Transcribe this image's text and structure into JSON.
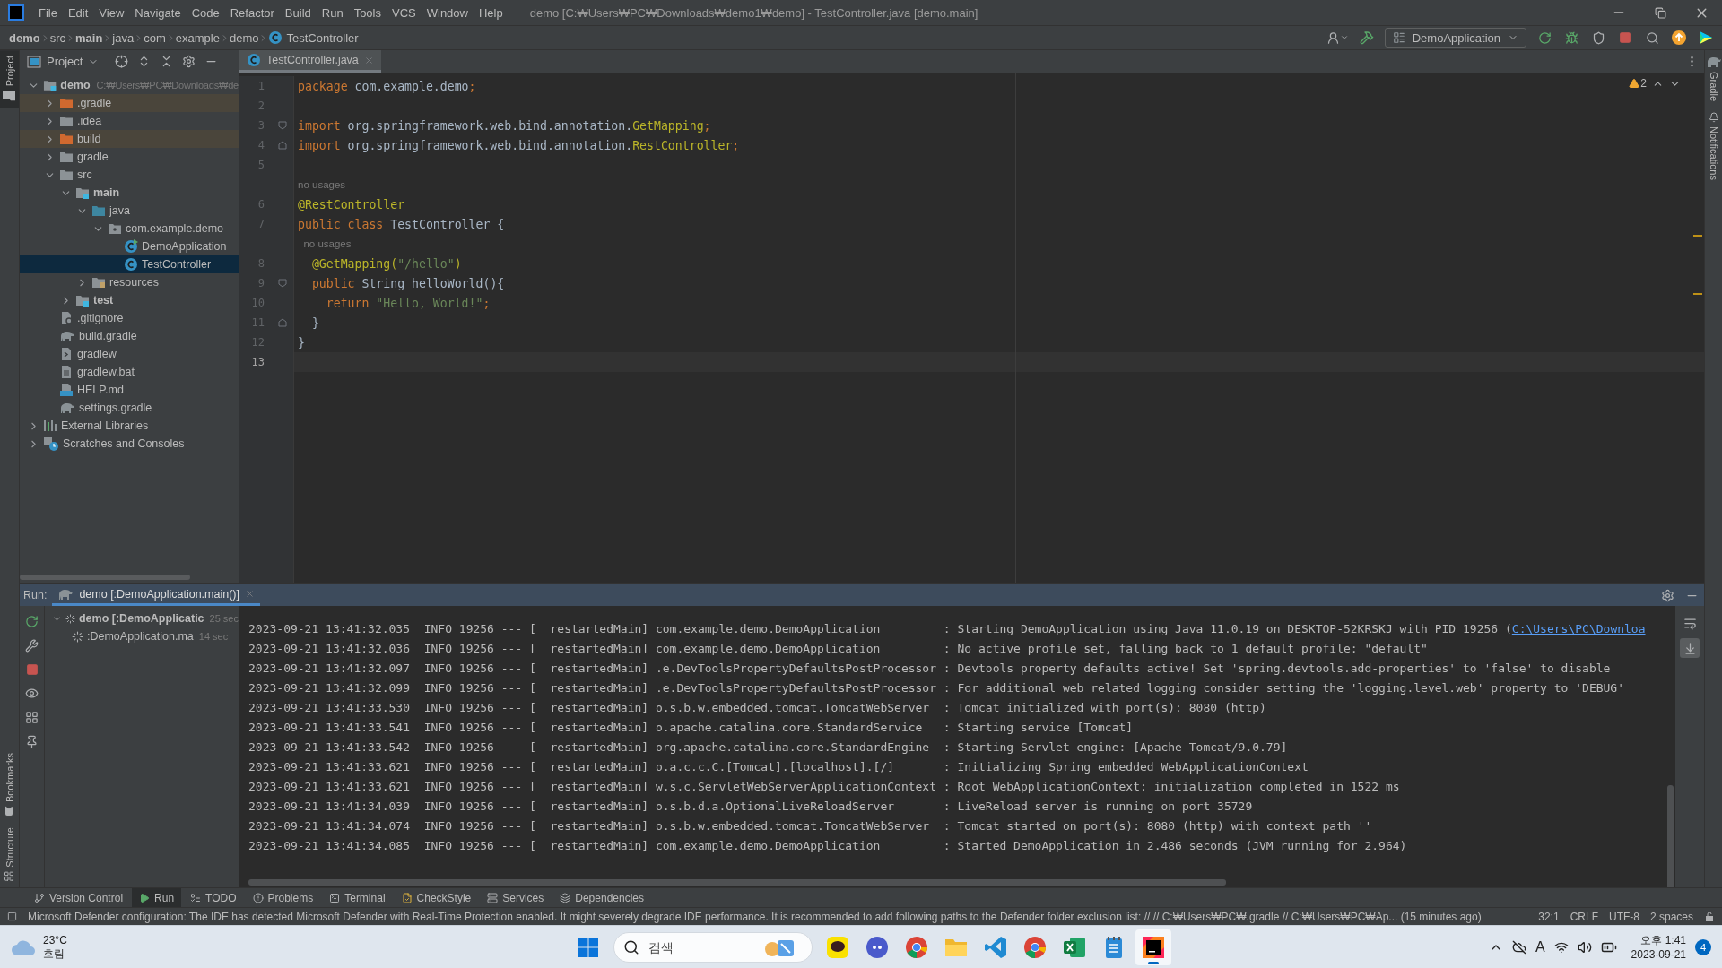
{
  "title_bar": {
    "menu": [
      "File",
      "Edit",
      "View",
      "Navigate",
      "Code",
      "Refactor",
      "Build",
      "Run",
      "Tools",
      "VCS",
      "Window",
      "Help"
    ],
    "title": "demo [C:₩Users₩PC₩Downloads₩demo1₩demo] - TestController.java [demo.main]"
  },
  "navigation_bar": {
    "breadcrumbs": [
      {
        "label": "demo",
        "kind": "module"
      },
      {
        "label": "src",
        "kind": "folder"
      },
      {
        "label": "main",
        "kind": "module"
      },
      {
        "label": "java",
        "kind": "folder"
      },
      {
        "label": "com",
        "kind": "folder"
      },
      {
        "label": "example",
        "kind": "folder"
      },
      {
        "label": "demo",
        "kind": "folder"
      },
      {
        "label": "TestController",
        "kind": "class"
      }
    ],
    "run_configuration": "DemoApplication"
  },
  "left_strip": {
    "top": [
      {
        "label": "Project",
        "selected": true
      }
    ],
    "bottom": [
      {
        "label": "Bookmarks",
        "selected": false
      },
      {
        "label": "Structure",
        "selected": false
      }
    ]
  },
  "right_strip": [
    {
      "label": "Gradle",
      "kind": "gradle"
    },
    {
      "label": "Notifications",
      "kind": "bell"
    }
  ],
  "project_panel": {
    "title": "Project",
    "tree": [
      {
        "label": "demo",
        "kind": "module",
        "hint": "C:₩Users₩PC₩Downloads₩de",
        "expanded": true,
        "selected": false,
        "children": [
          {
            "label": ".gradle",
            "kind": "excluded",
            "expanded": false,
            "selected": false
          },
          {
            "label": ".idea",
            "kind": "folder",
            "expanded": false,
            "selected": false
          },
          {
            "label": "build",
            "kind": "excluded",
            "expanded": false,
            "selected": false
          },
          {
            "label": "gradle",
            "kind": "folder",
            "expanded": false,
            "selected": false
          },
          {
            "label": "src",
            "kind": "folder",
            "expanded": true,
            "selected": false,
            "children": [
              {
                "label": "main",
                "kind": "source-root",
                "expanded": true,
                "selected": false,
                "children": [
                  {
                    "label": "java",
                    "kind": "source",
                    "expanded": true,
                    "selected": false,
                    "children": [
                      {
                        "label": "com.example.demo",
                        "kind": "package",
                        "expanded": true,
                        "selected": false,
                        "children": [
                          {
                            "label": "DemoApplication",
                            "kind": "main-class",
                            "selected": false
                          },
                          {
                            "label": "TestController",
                            "kind": "class",
                            "selected": true
                          }
                        ]
                      }
                    ]
                  },
                  {
                    "label": "resources",
                    "kind": "resources",
                    "expanded": false,
                    "selected": false
                  }
                ]
              },
              {
                "label": "test",
                "kind": "source-root",
                "expanded": false,
                "selected": false
              }
            ]
          },
          {
            "label": ".gitignore",
            "kind": "ignore",
            "selected": false
          },
          {
            "label": "build.gradle",
            "kind": "gradle",
            "selected": false
          },
          {
            "label": "gradlew",
            "kind": "script",
            "selected": false
          },
          {
            "label": "gradlew.bat",
            "kind": "text",
            "selected": false
          },
          {
            "label": "HELP.md",
            "kind": "markdown",
            "selected": false
          },
          {
            "label": "settings.gradle",
            "kind": "gradle",
            "selected": false
          }
        ]
      },
      {
        "label": "External Libraries",
        "kind": "libraries",
        "expanded": false,
        "selected": false
      },
      {
        "label": "Scratches and Consoles",
        "kind": "scratches",
        "expanded": false,
        "selected": false
      }
    ]
  },
  "editor": {
    "tabs": [
      {
        "label": "TestController.java",
        "selected": true
      }
    ],
    "warning_count": "2",
    "lines": [
      {
        "number": "1",
        "tokens": [
          {
            "kind": "keyword",
            "text": "package"
          },
          {
            "kind": "plain",
            "text": " com.example.demo"
          },
          {
            "kind": "keyword",
            "text": ";"
          }
        ]
      },
      {
        "number": "2"
      },
      {
        "number": "3",
        "fold_open": true,
        "tokens": [
          {
            "kind": "keyword",
            "text": "import"
          },
          {
            "kind": "plain",
            "text": " org.springframework.web.bind.annotation."
          },
          {
            "kind": "annotation",
            "text": "GetMapping"
          },
          {
            "kind": "keyword",
            "text": ";"
          }
        ]
      },
      {
        "number": "4",
        "fold_close": true,
        "tokens": [
          {
            "kind": "keyword",
            "text": "import"
          },
          {
            "kind": "plain",
            "text": " org.springframework.web.bind.annotation."
          },
          {
            "kind": "annotation",
            "text": "RestController"
          },
          {
            "kind": "keyword",
            "text": ";"
          }
        ]
      },
      {
        "number": "5"
      },
      {
        "tokens": [
          {
            "kind": "hint",
            "text": "no usages"
          }
        ]
      },
      {
        "number": "6",
        "tokens": [
          {
            "kind": "annotation",
            "text": "@RestController"
          }
        ]
      },
      {
        "number": "7",
        "tokens": [
          {
            "kind": "keyword",
            "text": "public class"
          },
          {
            "kind": "plain",
            "text": " TestController {"
          }
        ]
      },
      {
        "tokens": [
          {
            "kind": "hint",
            "text": "  no usages"
          }
        ]
      },
      {
        "number": "8",
        "tokens": [
          {
            "kind": "annotation",
            "text": "  @GetMapping("
          },
          {
            "kind": "string",
            "text": "\"/hello\""
          },
          {
            "kind": "annotation",
            "text": ")"
          }
        ]
      },
      {
        "number": "9",
        "fold_open": true,
        "tokens": [
          {
            "kind": "keyword",
            "text": "  public"
          },
          {
            "kind": "plain",
            "text": " String helloWorld(){"
          }
        ]
      },
      {
        "number": "10",
        "tokens": [
          {
            "kind": "keyword",
            "text": "    return"
          },
          {
            "kind": "string",
            "text": " \"Hello, World!\""
          },
          {
            "kind": "keyword",
            "text": ";"
          }
        ]
      },
      {
        "number": "11",
        "fold_close": true,
        "tokens": [
          {
            "kind": "plain",
            "text": "  }"
          }
        ]
      },
      {
        "number": "12",
        "tokens": [
          {
            "kind": "plain",
            "text": "}"
          }
        ]
      },
      {
        "number": "13",
        "current": true
      }
    ]
  },
  "run_panel": {
    "label": "Run:",
    "tabs": [
      {
        "label": "demo [:DemoApplication.main()]",
        "selected": true
      }
    ],
    "tree": [
      {
        "label": "demo [:DemoApplicatic",
        "time": "25 sec",
        "expanded": true,
        "children": [
          {
            "label": ":DemoApplication.ma",
            "time": "14 sec"
          }
        ]
      }
    ],
    "console": [
      {
        "text": "2023-09-21 13:41:32.035  INFO 19256 --- [  restartedMain] com.example.demo.DemoApplication         : Starting DemoApplication using Java 11.0.19 on DESKTOP-52KRSKJ with PID 19256 (",
        "link": "C:\\Users\\PC\\Downloa"
      },
      {
        "text": "2023-09-21 13:41:32.036  INFO 19256 --- [  restartedMain] com.example.demo.DemoApplication         : No active profile set, falling back to 1 default profile: \"default\""
      },
      {
        "text": "2023-09-21 13:41:32.097  INFO 19256 --- [  restartedMain] .e.DevToolsPropertyDefaultsPostProcessor : Devtools property defaults active! Set 'spring.devtools.add-properties' to 'false' to disable"
      },
      {
        "text": "2023-09-21 13:41:32.099  INFO 19256 --- [  restartedMain] .e.DevToolsPropertyDefaultsPostProcessor : For additional web related logging consider setting the 'logging.level.web' property to 'DEBUG'"
      },
      {
        "text": "2023-09-21 13:41:33.530  INFO 19256 --- [  restartedMain] o.s.b.w.embedded.tomcat.TomcatWebServer  : Tomcat initialized with port(s): 8080 (http)"
      },
      {
        "text": "2023-09-21 13:41:33.541  INFO 19256 --- [  restartedMain] o.apache.catalina.core.StandardService   : Starting service [Tomcat]"
      },
      {
        "text": "2023-09-21 13:41:33.542  INFO 19256 --- [  restartedMain] org.apache.catalina.core.StandardEngine  : Starting Servlet engine: [Apache Tomcat/9.0.79]"
      },
      {
        "text": "2023-09-21 13:41:33.621  INFO 19256 --- [  restartedMain] o.a.c.c.C.[Tomcat].[localhost].[/]       : Initializing Spring embedded WebApplicationContext"
      },
      {
        "text": "2023-09-21 13:41:33.621  INFO 19256 --- [  restartedMain] w.s.c.ServletWebServerApplicationContext : Root WebApplicationContext: initialization completed in 1522 ms"
      },
      {
        "text": "2023-09-21 13:41:34.039  INFO 19256 --- [  restartedMain] o.s.b.d.a.OptionalLiveReloadServer       : LiveReload server is running on port 35729"
      },
      {
        "text": "2023-09-21 13:41:34.074  INFO 19256 --- [  restartedMain] o.s.b.w.embedded.tomcat.TomcatWebServer  : Tomcat started on port(s): 8080 (http) with context path ''"
      },
      {
        "text": "2023-09-21 13:41:34.085  INFO 19256 --- [  restartedMain] com.example.demo.DemoApplication         : Started DemoApplication in 2.486 seconds (JVM running for 2.964)"
      }
    ]
  },
  "tool_window_bar": [
    {
      "label": "Version Control",
      "kind": "vcs",
      "selected": false
    },
    {
      "label": "Run",
      "kind": "run",
      "selected": true
    },
    {
      "label": "TODO",
      "kind": "todo",
      "selected": false
    },
    {
      "label": "Problems",
      "kind": "problems",
      "selected": false
    },
    {
      "label": "Terminal",
      "kind": "terminal",
      "selected": false
    },
    {
      "label": "CheckStyle",
      "kind": "checkstyle",
      "selected": false
    },
    {
      "label": "Services",
      "kind": "services",
      "selected": false
    },
    {
      "label": "Dependencies",
      "kind": "dependencies",
      "selected": false
    }
  ],
  "status_bar": {
    "message": "Microsoft Defender configuration: The IDE has detected Microsoft Defender with Real-Time Protection enabled. It might severely degrade IDE performance. It is recommended to add following paths to the Defender folder exclusion list: // //  C:₩Users₩PC₩.gradle //  C:₩Users₩PC₩Ap... (15 minutes ago)",
    "position": "32:1",
    "line_separator": "CRLF",
    "encoding": "UTF-8",
    "indent": "2 spaces"
  },
  "taskbar": {
    "weather": {
      "temperature": "23°C",
      "condition": "흐림"
    },
    "search_placeholder": "검색",
    "apps": [
      {
        "kind": "chat",
        "active": false
      },
      {
        "kind": "discord",
        "active": false
      },
      {
        "kind": "browser",
        "active": false
      },
      {
        "kind": "folder",
        "active": false
      },
      {
        "kind": "code",
        "active": false
      },
      {
        "kind": "browser",
        "active": false
      },
      {
        "kind": "spreadsheet",
        "active": false
      },
      {
        "kind": "notepad",
        "active": false
      },
      {
        "kind": "ide",
        "active": true
      }
    ],
    "ime": "A",
    "time": "오후 1:41",
    "date": "2023-09-21",
    "notifications": "4"
  }
}
